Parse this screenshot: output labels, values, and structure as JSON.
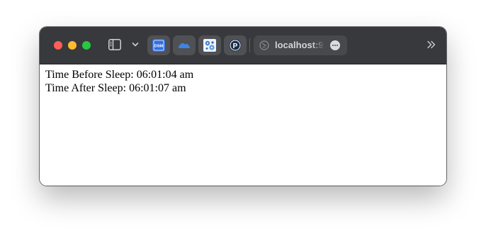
{
  "window": {
    "toolbar": {
      "favorites": [
        {
          "name": "dsm",
          "label": "DSM"
        },
        {
          "name": "onedrive",
          "label": ""
        },
        {
          "name": "settings-app",
          "label": ""
        },
        {
          "name": "p-app",
          "label": "P"
        }
      ],
      "url": "localhost:9",
      "colors": {
        "toolbar_bg": "#38393c",
        "close": "#fe5f57",
        "minimize": "#febc2e",
        "maximize": "#28c840",
        "dsm_blue": "#2f6fe4",
        "cloud_blue": "#3e84e6"
      },
      "icons": [
        "sidebar-icon",
        "chevron-down-icon",
        "globe-icon",
        "more-icon",
        "double-chevron-right-icon"
      ]
    }
  },
  "page": {
    "lines": [
      "Time Before Sleep: 06:01:04 am",
      "Time After Sleep: 06:01:07 am"
    ]
  }
}
